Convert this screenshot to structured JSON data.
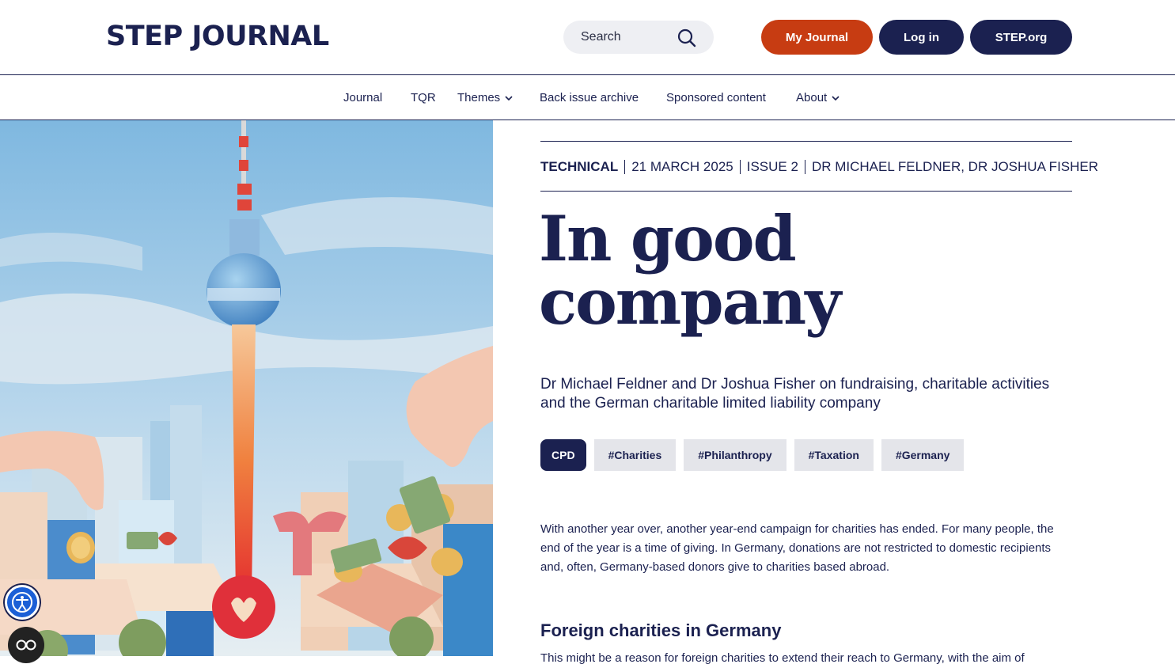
{
  "header": {
    "logo": "STEP JOURNAL",
    "search_placeholder": "Search",
    "buttons": {
      "my_journal": "My Journal",
      "login": "Log in",
      "step_org": "STEP.org"
    }
  },
  "nav": {
    "items": [
      {
        "label": "Journal"
      },
      {
        "label": "TQR"
      },
      {
        "label": "Themes"
      },
      {
        "label": "Back issue archive"
      },
      {
        "label": "Sponsored content"
      },
      {
        "label": "About"
      }
    ]
  },
  "article": {
    "category": "TECHNICAL",
    "date": "21 MARCH 2025",
    "issue": "ISSUE 2",
    "authors": "DR MICHAEL FELDNER, DR JOSHUA FISHER",
    "title_line1": "In good",
    "title_line2": "company",
    "standfirst": "Dr Michael Feldner and Dr Joshua Fisher on fundraising, charitable activities and the German charitable limited liability company",
    "tags": [
      "CPD",
      "#Charities",
      "#Philanthropy",
      "#Taxation",
      "#Germany"
    ],
    "paragraph1": "With another year over, another year-end campaign for charities has ended. For many people, the end of the year is a time of giving. In Germany, donations are not restricted to domestic recipients and, often, Germany-based donors give to charities based abroad.",
    "heading2": "Foreign charities in Germany",
    "paragraph2": "This might be a reason for foreign charities to extend their reach to Germany, with the aim of"
  },
  "colors": {
    "navy": "#1b2150",
    "accent_orange": "#c73c12",
    "tag_bg": "#e4e5ea"
  },
  "icons": {
    "search": "search-icon",
    "accessibility": "accessibility-icon",
    "cookie": "cookie-settings-icon"
  }
}
